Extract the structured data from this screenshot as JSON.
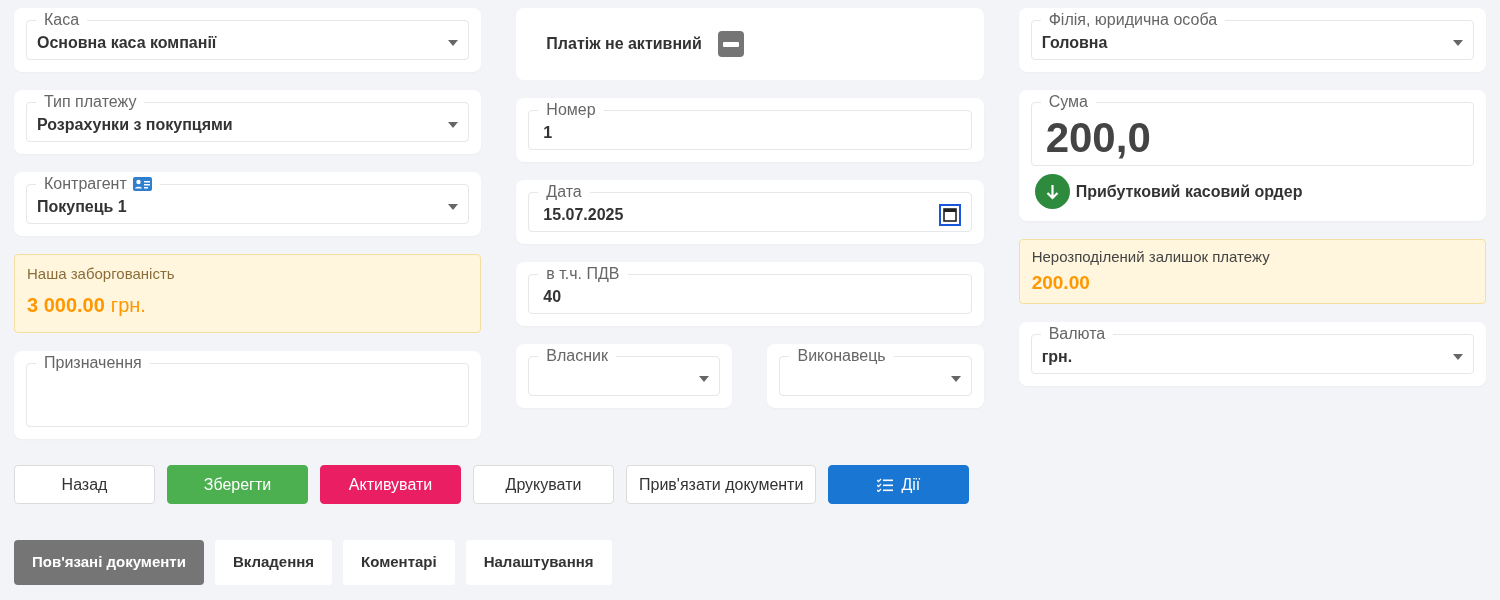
{
  "left": {
    "cash_desk": {
      "label": "Каса",
      "value": "Основна каса компанії"
    },
    "payment_type": {
      "label": "Тип платежу",
      "value": "Розрахунки з покупцями"
    },
    "counterparty": {
      "label": "Контрагент",
      "value": "Покупець 1"
    },
    "debt": {
      "label": "Наша заборгованість",
      "amount": "3 000.00",
      "currency": "грн."
    },
    "purpose": {
      "label": "Призначення"
    }
  },
  "middle": {
    "status": {
      "label": "Платіж не активний",
      "active": false
    },
    "number": {
      "label": "Номер",
      "value": "1"
    },
    "date": {
      "label": "Дата",
      "value": "15.07.2025"
    },
    "vat": {
      "label": "в т.ч. ПДВ",
      "value": "40"
    },
    "owner": {
      "label": "Власник"
    },
    "executor": {
      "label": "Виконавець"
    }
  },
  "right": {
    "branch": {
      "label": "Філія, юридична особа",
      "value": "Головна"
    },
    "sum": {
      "label": "Сума",
      "value": "200,0",
      "order_type": "Прибутковий касовий ордер"
    },
    "unallocated": {
      "label": "Нерозподілений залишок платежу",
      "amount": "200.00"
    },
    "currency": {
      "label": "Валюта",
      "value": "грн."
    }
  },
  "buttons": [
    {
      "label": "Назад",
      "kind": "default"
    },
    {
      "label": "Зберегти",
      "kind": "success"
    },
    {
      "label": "Активувати",
      "kind": "danger"
    },
    {
      "label": "Друкувати",
      "kind": "default"
    },
    {
      "label": "Прив'язати документи",
      "kind": "default"
    },
    {
      "label": "Дії",
      "kind": "primary"
    }
  ],
  "tabs": [
    {
      "label": "Пов'язані документи",
      "selected": true
    },
    {
      "label": "Вкладення",
      "selected": false
    },
    {
      "label": "Коментарі",
      "selected": false
    },
    {
      "label": "Налаштування",
      "selected": false
    }
  ]
}
